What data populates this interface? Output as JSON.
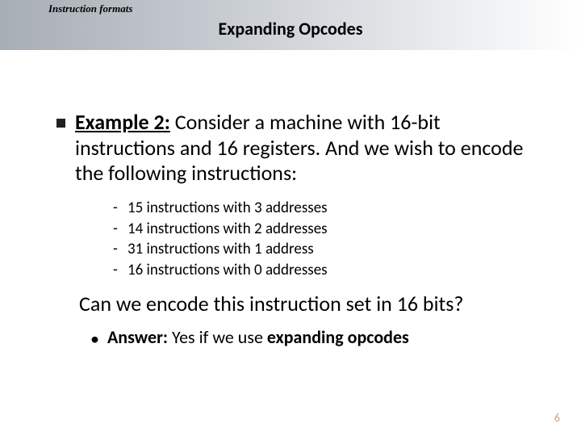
{
  "header": {
    "breadcrumb": "Instruction formats",
    "title": "Expanding Opcodes"
  },
  "main": {
    "example_label": "Example 2:",
    "example_text": " Consider a machine with 16-bit instructions and 16 registers. And we wish to encode the following instructions:"
  },
  "sublist": [
    "15 instructions with 3 addresses",
    "14 instructions with 2 addresses",
    "31 instructions with 1 address",
    "16 instructions with 0 addresses"
  ],
  "question": "Can we encode this instruction set in 16 bits?",
  "answer": {
    "label": "Answer:",
    "mid": " Yes if we use ",
    "emph": "expanding opcodes"
  },
  "page_number": "6"
}
